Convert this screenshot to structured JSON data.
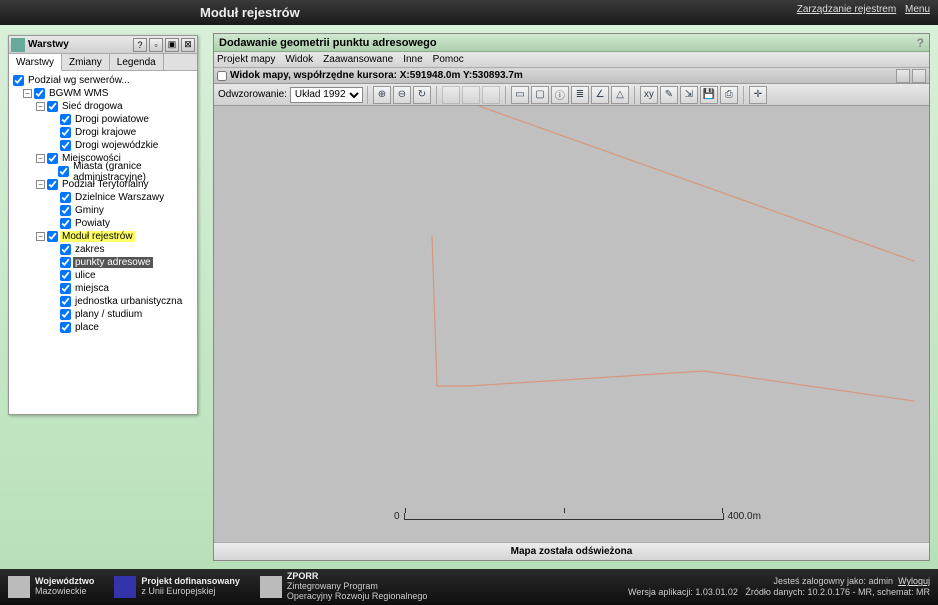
{
  "topbar": {
    "title": "Moduł rejestrów",
    "manage": "Zarządzanie rejestrem",
    "menu": "Menu"
  },
  "layers": {
    "title": "Warstwy",
    "tabs": {
      "layers": "Warstwy",
      "changes": "Zmiany",
      "legend": "Legenda"
    }
  },
  "tree": {
    "root": "Podział wg serwerów...",
    "bgwm": "BGWM WMS",
    "siec": "Sieć drogowa",
    "dp": "Drogi powiatowe",
    "dk": "Drogi krajowe",
    "dw": "Drogi wojewódzkie",
    "miejsc": "Miejscowości",
    "miasta": "Miasta (granice administracyjne)",
    "podzial": "Podział Terytorialny",
    "dziel": "Dzielnice Warszawy",
    "gminy": "Gminy",
    "powiaty": "Powiaty",
    "modul": "Moduł rejestrów",
    "zakres": "zakres",
    "punkty": "punkty adresowe",
    "ulice": "ulice",
    "miejsca": "miejsca",
    "jedn": "jednostka urbanistyczna",
    "plany": "plany / studium",
    "place": "place"
  },
  "map": {
    "title": "Dodawanie geometrii punktu adresowego",
    "menu": {
      "projekt": "Projekt mapy",
      "widok": "Widok",
      "zaaw": "Zaawansowane",
      "inne": "Inne",
      "pomoc": "Pomoc"
    },
    "coord_label": "Widok mapy, współrzędne kursora: X:591948.0m Y:530893.7m",
    "proj_label": "Odwzorowanie:",
    "proj_value": "Układ 1992",
    "status": "Mapa została odświeżona",
    "scale_start": "0",
    "scale_end": "400.0m"
  },
  "footer": {
    "woj1": "Województwo",
    "woj2": "Mazowieckie",
    "ue1": "Projekt dofinansowany",
    "ue2": "z Unii Europejskiej",
    "zporr_t": "ZPORR",
    "zporr_1": "Zintegrowany Program",
    "zporr_2": "Operacyjny Rozwoju Regionalnego",
    "logged": "Jesteś zalogowny jako: admin",
    "logout": "Wyloguj",
    "ver": "Wersja aplikacji: 1.03.01.02",
    "src": "Źródło danych: 10.2.0.176 - MR, schemat: MR"
  }
}
